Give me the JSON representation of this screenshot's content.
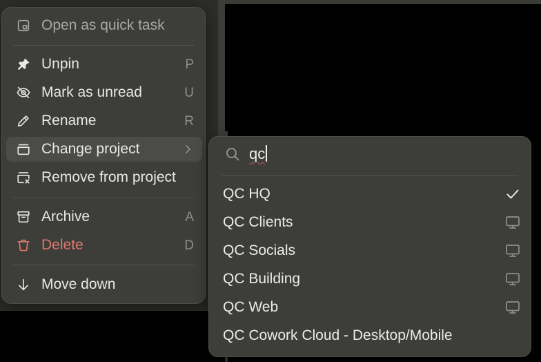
{
  "menu": {
    "items": [
      {
        "label": "Open as quick task",
        "key": "",
        "icon": "quick-task-icon"
      },
      {
        "label": "Unpin",
        "key": "P",
        "icon": "pin-icon"
      },
      {
        "label": "Mark as unread",
        "key": "U",
        "icon": "eye-slash-icon"
      },
      {
        "label": "Rename",
        "key": "R",
        "icon": "pencil-icon"
      },
      {
        "label": "Change project",
        "key": "",
        "icon": "folder-tray-icon"
      },
      {
        "label": "Remove from project",
        "key": "",
        "icon": "folder-remove-icon"
      },
      {
        "label": "Archive",
        "key": "A",
        "icon": "archive-icon"
      },
      {
        "label": "Delete",
        "key": "D",
        "icon": "trash-icon"
      },
      {
        "label": "Move down",
        "key": "",
        "icon": "arrow-down-icon"
      }
    ]
  },
  "submenu": {
    "search": {
      "value": "qc",
      "placeholder": ""
    },
    "projects": [
      {
        "label": "QC HQ",
        "trailing": "checkmark-icon"
      },
      {
        "label": "QC Clients",
        "trailing": "monitor-icon"
      },
      {
        "label": "QC Socials",
        "trailing": "monitor-icon"
      },
      {
        "label": "QC Building",
        "trailing": "monitor-icon"
      },
      {
        "label": "QC Web",
        "trailing": "monitor-icon"
      },
      {
        "label": "QC Cowork Cloud - Desktop/Mobile",
        "trailing": ""
      }
    ]
  },
  "colors": {
    "menu_bg": "#3d3d3a",
    "text": "#e8e8e4",
    "muted_text": "#a9a9a3",
    "danger": "#e07a6e",
    "highlight": "#4b4b48",
    "shortcut": "#8f8f8a"
  }
}
